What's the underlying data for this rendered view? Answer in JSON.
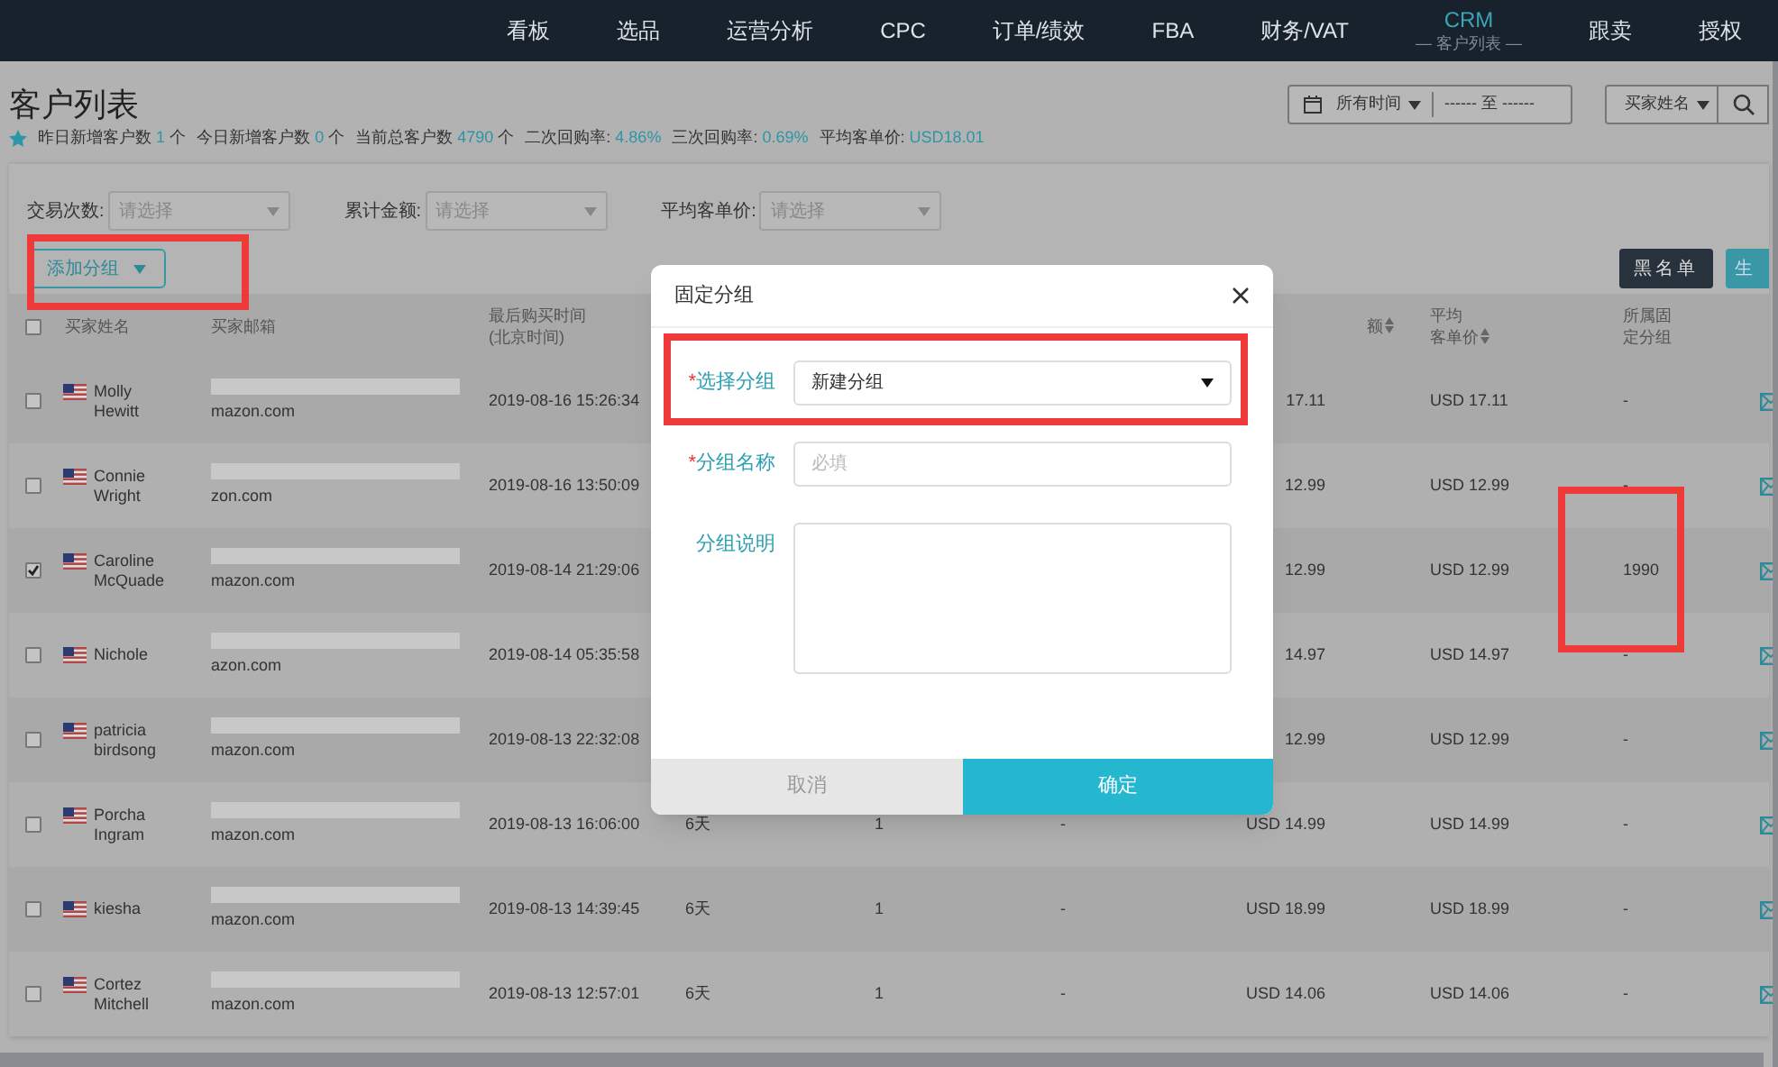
{
  "nav": {
    "items": [
      {
        "label": "看板",
        "selected": false
      },
      {
        "label": "选品",
        "selected": false
      },
      {
        "label": "运营分析",
        "selected": false
      },
      {
        "label": "CPC",
        "selected": false
      },
      {
        "label": "订单/绩效",
        "selected": false
      },
      {
        "label": "FBA",
        "selected": false
      },
      {
        "label": "财务/VAT",
        "selected": false
      },
      {
        "label": "CRM",
        "selected": true,
        "subtitle": "— 客户列表 —"
      },
      {
        "label": "跟卖",
        "selected": false
      },
      {
        "label": "授权",
        "selected": false
      }
    ]
  },
  "page": {
    "title": "客户列表",
    "stats": [
      {
        "label": "昨日新增客户数",
        "value": "1",
        "unit": "个"
      },
      {
        "label": "今日新增客户数",
        "value": "0",
        "unit": "个"
      },
      {
        "label": "当前总客户数",
        "value": "4790",
        "unit": "个"
      },
      {
        "label": "二次回购率:",
        "value": "4.86%"
      },
      {
        "label": "三次回购率:",
        "value": "0.69%"
      },
      {
        "label": "平均客单价:",
        "value": "USD18.01"
      }
    ]
  },
  "date_filter": {
    "preset": "所有时间",
    "range": "------ 至 ------"
  },
  "search": {
    "field": "买家姓名"
  },
  "filters": [
    {
      "label": "交易次数:",
      "placeholder": "请选择"
    },
    {
      "label": "累计金额:",
      "placeholder": "请选择"
    },
    {
      "label": "平均客单价:",
      "placeholder": "请选择"
    }
  ],
  "add_group_button": "添加分组",
  "blacklist_button": "黑名单",
  "generate_button": "生",
  "table": {
    "header_checked": false,
    "header": {
      "name": "买家姓名",
      "email": "买家邮箱",
      "last_purchase": "最后购买时间\n(北京时间)",
      "column_7": "额",
      "column_7_sortable": true,
      "average_order": [
        "平均",
        "客单价"
      ],
      "average_order_sortable": true,
      "fixed_group": "所属固定分组"
    },
    "rows": [
      {
        "checked": false,
        "name": "Molly\nHewitt",
        "email": "mazon.com",
        "last_purchase": "2019-08-16 15:26:34",
        "column_7": "17.11",
        "average_order": "USD 17.11",
        "fixed_group": "-"
      },
      {
        "checked": false,
        "name": "Connie\nWright",
        "email": "zon.com",
        "last_purchase": "2019-08-16 13:50:09",
        "column_7": "12.99",
        "average_order": "USD 12.99",
        "fixed_group": "-"
      },
      {
        "checked": true,
        "name": "Caroline\nMcQuade",
        "email": "mazon.com",
        "last_purchase": "2019-08-14 21:29:06",
        "column_7": "12.99",
        "average_order": "USD 12.99",
        "fixed_group": "1990"
      },
      {
        "checked": false,
        "name": "Nichole",
        "email": "azon.com",
        "last_purchase": "2019-08-14 05:35:58",
        "column_7": "14.97",
        "average_order": "USD 14.97",
        "fixed_group": "-"
      },
      {
        "checked": false,
        "name": "patricia\nbirdsong",
        "email": "mazon.com",
        "last_purchase": "2019-08-13 22:32:08",
        "column_7": "12.99",
        "average_order": "USD 12.99",
        "fixed_group": "-"
      },
      {
        "checked": false,
        "name": "Porcha\nIngram",
        "email": "mazon.com",
        "last_purchase": "2019-08-13 16:06:00",
        "column_4": "6天",
        "column_5": "1",
        "column_6": "-",
        "column_7": "USD 14.99",
        "average_order": "USD 14.99",
        "fixed_group": "-"
      },
      {
        "checked": false,
        "name": "kiesha",
        "email": "mazon.com",
        "last_purchase": "2019-08-13 14:39:45",
        "column_4": "6天",
        "column_5": "1",
        "column_6": "-",
        "column_7": "USD 18.99",
        "average_order": "USD 18.99",
        "fixed_group": "-"
      },
      {
        "checked": false,
        "name": "Cortez\nMitchell",
        "email": "mazon.com",
        "last_purchase": "2019-08-13 12:57:01",
        "column_4": "6天",
        "column_5": "1",
        "column_6": "-",
        "column_7": "USD 14.06",
        "average_order": "USD 14.06",
        "fixed_group": "-"
      }
    ]
  },
  "modal": {
    "title": "固定分组",
    "fields": [
      {
        "kind": "select",
        "required_mark": "*",
        "label": "选择分组",
        "value": "新建分组"
      },
      {
        "kind": "input",
        "required_mark": "*",
        "label": "分组名称",
        "placeholder": "必填"
      },
      {
        "kind": "textarea",
        "label": "分组说明"
      }
    ],
    "buttons": [
      {
        "kind": "cancel",
        "label": "取消"
      },
      {
        "kind": "primary",
        "label": "确定"
      }
    ]
  }
}
